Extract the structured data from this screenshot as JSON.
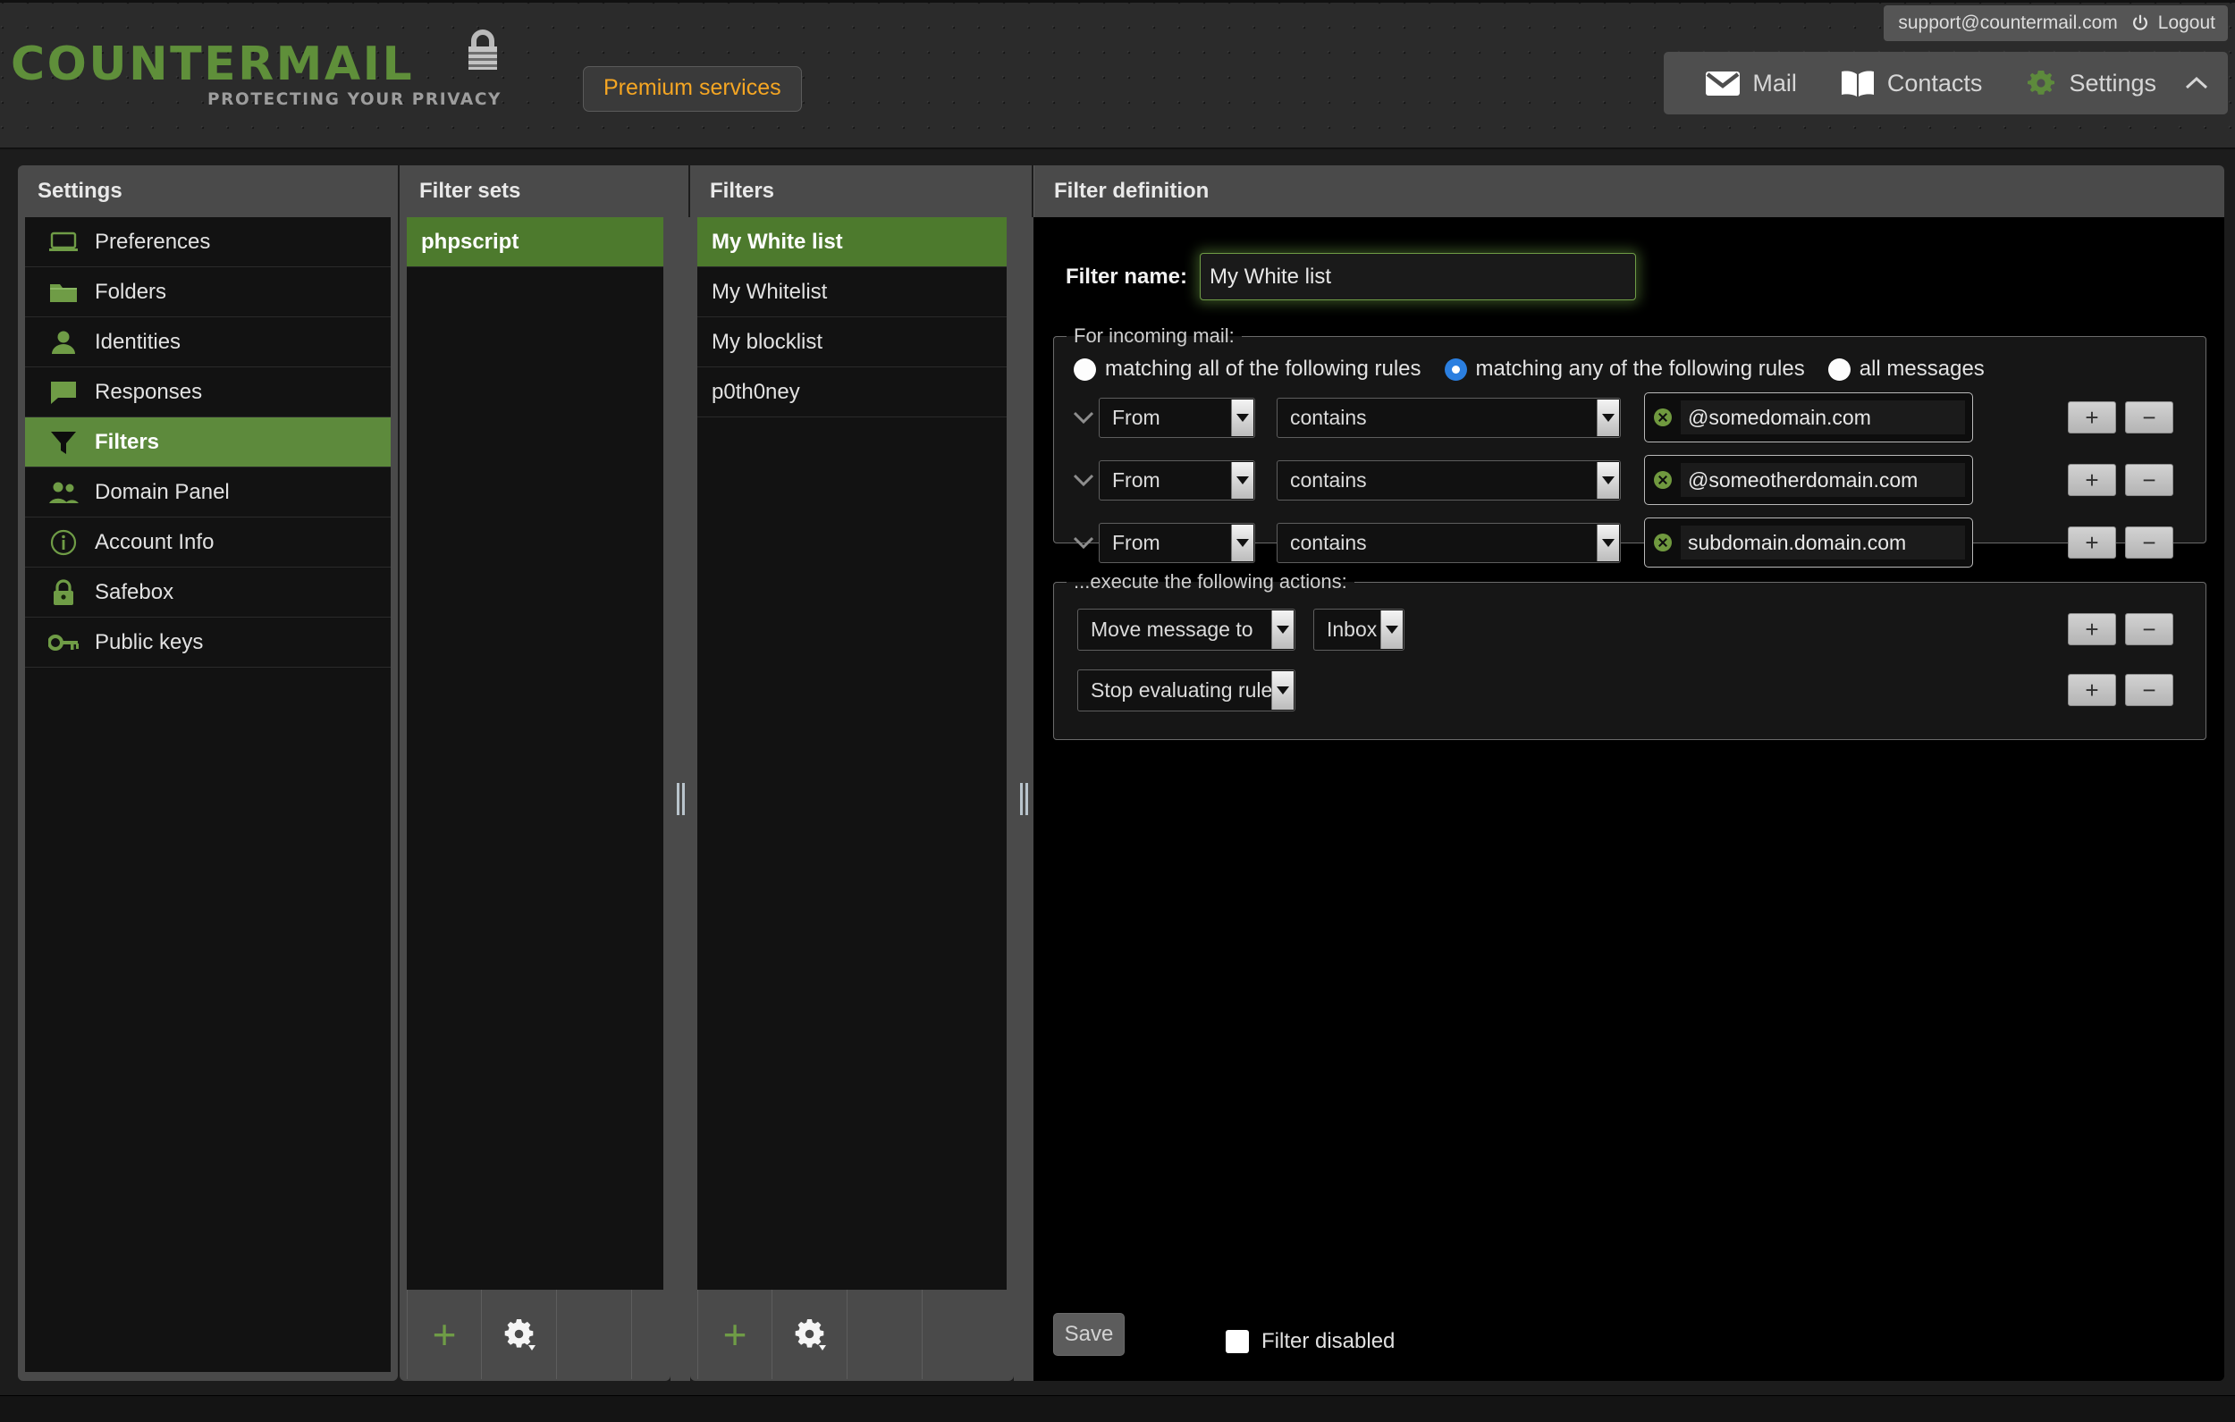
{
  "brand": {
    "logo_text": "COUNTERMAIL",
    "tagline": "PROTECTING YOUR PRIVACY",
    "logo_color": "#5f8f3a",
    "accent_green": "#5d8a3c",
    "premium_color": "#f5a623"
  },
  "topbar": {
    "premium_label": "Premium services",
    "account_email": "support@countermail.com",
    "logout_label": "Logout",
    "nav": [
      {
        "label": "Mail",
        "icon": "envelope-icon",
        "active": false
      },
      {
        "label": "Contacts",
        "icon": "book-icon",
        "active": false
      },
      {
        "label": "Settings",
        "icon": "gear-icon",
        "active": true
      }
    ],
    "collapse_icon": "chevron-up-icon"
  },
  "columns": {
    "settings_header": "Settings",
    "filtersets_header": "Filter sets",
    "filters_header": "Filters",
    "definition_header": "Filter definition"
  },
  "sidebar": {
    "items": [
      {
        "label": "Preferences",
        "icon": "laptop-icon",
        "active": false
      },
      {
        "label": "Folders",
        "icon": "folder-icon",
        "active": false
      },
      {
        "label": "Identities",
        "icon": "person-icon",
        "active": false
      },
      {
        "label": "Responses",
        "icon": "speech-icon",
        "active": false
      },
      {
        "label": "Filters",
        "icon": "funnel-icon",
        "active": true
      },
      {
        "label": "Domain Panel",
        "icon": "people-icon",
        "active": false
      },
      {
        "label": "Account Info",
        "icon": "info-icon",
        "active": false
      },
      {
        "label": "Safebox",
        "icon": "padlock-icon",
        "active": false
      },
      {
        "label": "Public keys",
        "icon": "key-icon",
        "active": false
      }
    ]
  },
  "filter_sets": {
    "items": [
      {
        "label": "phpscript",
        "selected": true
      }
    ],
    "toolbar": {
      "add_icon": "plus-icon",
      "options_icon": "gear-dropdown-icon"
    }
  },
  "filters": {
    "items": [
      {
        "label": "My White list",
        "selected": true
      },
      {
        "label": "My Whitelist",
        "selected": false
      },
      {
        "label": "My blocklist",
        "selected": false
      },
      {
        "label": "p0th0ney",
        "selected": false
      }
    ],
    "toolbar": {
      "add_icon": "plus-icon",
      "options_icon": "gear-dropdown-icon"
    }
  },
  "definition": {
    "filter_name_label": "Filter name:",
    "filter_name_value": "My White list",
    "incoming_legend": "For incoming mail:",
    "match_options": [
      {
        "label": "matching all of the following rules",
        "selected": false
      },
      {
        "label": "matching any of the following rules",
        "selected": true
      },
      {
        "label": "all messages",
        "selected": false
      }
    ],
    "rules": [
      {
        "field": "From",
        "operator": "contains",
        "value": "@somedomain.com"
      },
      {
        "field": "From",
        "operator": "contains",
        "value": "@someotherdomain.com"
      },
      {
        "field": "From",
        "operator": "contains",
        "value": "subdomain.domain.com"
      }
    ],
    "actions_legend": "...execute the following actions:",
    "actions": [
      {
        "action": "Move message to",
        "target": "Inbox"
      },
      {
        "action": "Stop evaluating rules",
        "target": null
      }
    ],
    "add_label": "+",
    "remove_label": "−",
    "save_label": "Save",
    "disabled_label": "Filter disabled",
    "disabled_checked": false
  }
}
